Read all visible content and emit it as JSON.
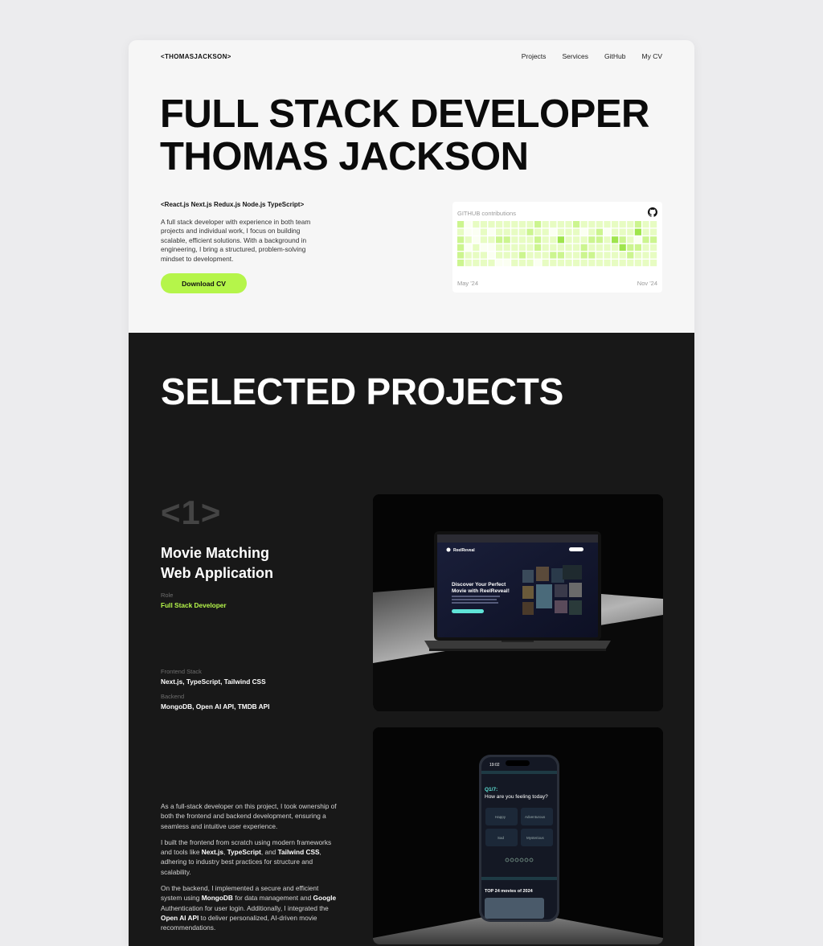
{
  "header": {
    "logo": "<THOMASJACKSON>",
    "nav": [
      "Projects",
      "Services",
      "GitHub",
      "My CV"
    ]
  },
  "hero": {
    "line1": "FULL STACK DEVELOPER",
    "line2": "THOMAS JACKSON"
  },
  "intro": {
    "stack": "<React.js Next.js Redux.js Node.js TypeScript>",
    "text": "A full stack developer with experience in both team projects and individual work, I focus on building scalable, efficient solutions. With a background in engineering, I bring a structured, problem-solving mindset to development.",
    "download_label": "Download CV"
  },
  "github": {
    "title": "GITHUB contributions",
    "from": "May '24",
    "to": "Nov '24",
    "icon": "github-icon",
    "levels": [
      [
        2,
        0,
        1,
        1,
        1,
        1,
        1,
        1,
        1,
        1,
        2,
        1,
        1,
        1,
        1,
        2,
        1,
        1,
        1,
        1,
        1,
        1,
        1,
        2,
        1,
        1,
        0,
        1,
        1,
        1,
        1,
        1,
        1,
        1,
        1,
        0,
        1,
        1,
        1,
        1,
        0,
        0,
        0,
        0,
        0,
        0,
        0,
        0,
        0,
        0,
        0,
        0,
        0,
        0,
        0,
        0
      ],
      [
        1,
        0,
        0,
        1,
        0,
        1,
        1,
        1,
        1,
        2,
        1,
        1,
        0,
        1,
        1,
        1,
        0,
        1,
        2,
        0,
        1,
        1,
        1,
        3,
        1,
        1,
        0,
        1,
        2,
        1,
        3,
        1,
        1,
        1,
        2,
        1,
        1,
        1,
        0,
        1,
        0,
        0,
        0,
        0,
        0,
        0,
        0,
        0,
        0,
        0,
        0,
        0,
        0,
        0,
        0,
        0
      ],
      [
        2,
        1,
        0,
        1,
        1,
        2,
        2,
        1,
        1,
        1,
        2,
        1,
        1,
        3,
        1,
        1,
        1,
        2,
        2,
        1,
        3,
        2,
        1,
        0,
        2,
        2,
        1,
        1,
        1,
        2,
        1,
        1,
        1,
        2,
        1,
        0,
        1,
        1,
        1,
        0,
        0,
        0,
        0,
        0,
        0,
        0,
        0,
        0,
        0,
        0,
        0,
        0,
        0,
        0,
        0,
        0
      ],
      [
        2,
        0,
        1,
        0,
        0,
        1,
        1,
        1,
        1,
        1,
        2,
        1,
        1,
        1,
        1,
        1,
        2,
        1,
        1,
        1,
        1,
        3,
        2,
        2,
        1,
        1,
        1,
        2,
        2,
        2,
        1,
        1,
        2,
        1,
        1,
        1,
        2,
        1,
        1,
        1,
        0,
        0,
        0,
        0,
        0,
        0,
        0,
        0,
        0,
        0,
        0,
        0,
        0,
        0,
        0,
        0
      ],
      [
        2,
        1,
        1,
        1,
        0,
        1,
        1,
        1,
        2,
        1,
        1,
        1,
        2,
        2,
        1,
        1,
        2,
        2,
        1,
        1,
        1,
        1,
        2,
        1,
        1,
        1,
        0,
        1,
        1,
        2,
        2,
        1,
        2,
        1,
        1,
        1,
        1,
        1,
        1,
        1,
        0,
        0,
        0,
        0,
        0,
        0,
        0,
        0,
        0,
        0,
        0,
        0,
        0,
        0,
        0,
        0
      ],
      [
        2,
        1,
        1,
        1,
        1,
        0,
        0,
        1,
        1,
        1,
        0,
        1,
        1,
        1,
        1,
        1,
        1,
        1,
        1,
        1,
        1,
        1,
        1,
        1,
        1,
        1,
        1,
        1,
        1,
        1,
        1,
        1,
        1,
        1,
        1,
        1,
        2,
        1,
        1,
        1,
        0,
        0,
        0,
        0,
        0,
        0,
        0,
        0,
        0,
        0,
        0,
        0,
        0,
        0,
        0,
        0
      ],
      [
        0,
        0,
        0,
        0,
        0,
        0,
        0,
        0,
        0,
        0,
        0,
        0,
        0,
        0,
        0,
        0,
        0,
        0,
        0,
        0,
        0,
        0,
        0,
        0,
        0,
        0,
        0,
        0,
        0,
        0,
        0,
        0,
        0,
        0,
        0,
        0,
        0,
        0,
        0,
        0,
        0,
        0,
        0,
        0,
        0,
        0,
        0,
        0,
        0,
        0,
        0,
        0,
        0,
        0,
        0,
        0
      ]
    ],
    "colors": [
      "#fbfff2",
      "#e7fcc2",
      "#ccf58f",
      "#9fe54c"
    ]
  },
  "projects": {
    "section_title": "SELECTED PROJECTS",
    "number": "<1>",
    "title_line1": "Movie Matching",
    "title_line2": "Web Application",
    "role_label": "Role",
    "role_value": "Full Stack Developer",
    "frontend_label": "Frontend Stack",
    "frontend_value": "Next.js, TypeScript, Tailwind CSS",
    "backend_label": "Backend",
    "backend_value": "MongoDB, Open AI API, TMDB API",
    "desc1": "As a full-stack developer on this project, I took ownership of both the frontend and backend development, ensuring a seamless and intuitive user experience.",
    "desc2": {
      "t1": "I built the frontend from scratch using modern frameworks and tools like ",
      "b1": "Next.js",
      "t2": ", ",
      "b2": "TypeScript",
      "t3": ", and ",
      "b3": "Tailwind CSS",
      "t4": ", adhering to industry best practices for structure and scalability."
    },
    "desc3": {
      "t1": "On the backend, I implemented a secure and efficient system using ",
      "b1": "MongoDB",
      "t2": " for data management and ",
      "b2": "Google",
      "t3": " Authentication for user login. Additionally, I integrated the ",
      "b3": "Open AI API",
      "t4": " to deliver personalized, AI-driven movie recommendations."
    },
    "laptop_screen": {
      "brand": "ReelReveal",
      "headline1": "Discover Your Perfect",
      "headline2": "Movie with ReelReveal!"
    },
    "phone_screen": {
      "time": "19:02",
      "question_prefix": "Q1/7:",
      "question": "How are you feeling today?",
      "options": [
        "Happy",
        "Adventurous",
        "Sad",
        "Mysterious"
      ],
      "top_label": "TOP 24 movies of 2024"
    }
  }
}
